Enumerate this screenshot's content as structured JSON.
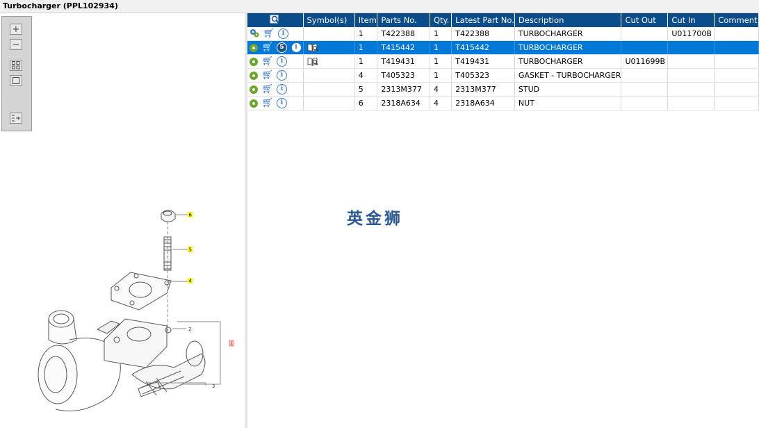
{
  "window": {
    "title": "Turbocharger (PPL102934)"
  },
  "toolbar": {
    "buttons": [
      "zoom-in-icon",
      "zoom-out-icon",
      "fit-all-icon",
      "fit-single-icon",
      "show-list-icon"
    ]
  },
  "drawing": {
    "callouts": [
      {
        "label": "6",
        "highlighted": true
      },
      {
        "label": "5",
        "highlighted": true
      },
      {
        "label": "4",
        "highlighted": true
      },
      {
        "label": "2",
        "highlighted": false
      },
      {
        "label": "1",
        "highlighted": "red"
      },
      {
        "label": "3",
        "highlighted": false
      }
    ]
  },
  "grid": {
    "columns": [
      "",
      "Symbol(s)",
      "Item",
      "Parts No.",
      "Qty.",
      "Latest Part No.",
      "Description",
      "Cut Out",
      "Cut In",
      "Comment"
    ],
    "rows": [
      {
        "icons": [
          "gear-multi-icon",
          "cart-icon",
          "info-icon"
        ],
        "symbol": "",
        "item": "1",
        "part_no": "T422388",
        "qty": "1",
        "latest": "T422388",
        "description": "TURBOCHARGER",
        "cut_out": "",
        "cut_in": "U011700B",
        "comment": "",
        "selected": false
      },
      {
        "icons": [
          "gear-icon",
          "cart-icon",
          "s-badge-icon",
          "info-icon"
        ],
        "symbol": "book-search-icon",
        "item": "1",
        "part_no": "T415442",
        "qty": "1",
        "latest": "T415442",
        "description": "TURBOCHARGER",
        "cut_out": "",
        "cut_in": "",
        "comment": "",
        "selected": true
      },
      {
        "icons": [
          "gear-icon",
          "cart-icon",
          "info-icon"
        ],
        "symbol": "book-search-icon",
        "item": "1",
        "part_no": "T419431",
        "qty": "1",
        "latest": "T419431",
        "description": "TURBOCHARGER",
        "cut_out": "U011699B",
        "cut_in": "",
        "comment": "",
        "selected": false
      },
      {
        "icons": [
          "gear-icon",
          "cart-icon",
          "info-icon"
        ],
        "symbol": "",
        "item": "4",
        "part_no": "T405323",
        "qty": "1",
        "latest": "T405323",
        "description": "GASKET - TURBOCHARGER",
        "cut_out": "",
        "cut_in": "",
        "comment": "",
        "selected": false
      },
      {
        "icons": [
          "gear-icon",
          "cart-icon",
          "info-icon"
        ],
        "symbol": "",
        "item": "5",
        "part_no": "2313M377",
        "qty": "4",
        "latest": "2313M377",
        "description": "STUD",
        "cut_out": "",
        "cut_in": "",
        "comment": "",
        "selected": false
      },
      {
        "icons": [
          "gear-icon",
          "cart-icon",
          "info-icon"
        ],
        "symbol": "",
        "item": "6",
        "part_no": "2318A634",
        "qty": "4",
        "latest": "2318A634",
        "description": "NUT",
        "cut_out": "",
        "cut_in": "",
        "comment": "",
        "selected": false
      }
    ]
  },
  "watermark": "英金狮",
  "colors": {
    "header_bg": "#0b4c8a",
    "selected_row": "#0078d7",
    "callout_highlight": "#ffff00"
  }
}
